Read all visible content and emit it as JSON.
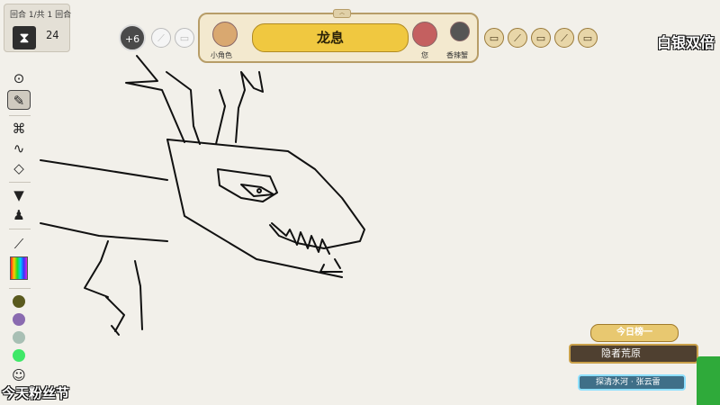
{
  "round": {
    "label": "回合 1/共 1 回合",
    "timer": "24",
    "hourglass_icon": "hourglass-icon"
  },
  "toolbar": {
    "tools": [
      {
        "name": "dot-brush-icon",
        "glyph": "⊙",
        "selected": false
      },
      {
        "name": "pen-icon",
        "glyph": "✎",
        "selected": true
      },
      {
        "name": "shape-tool-icon",
        "glyph": "⌘",
        "selected": false
      },
      {
        "name": "squiggle-icon",
        "glyph": "∿",
        "selected": false
      },
      {
        "name": "eraser-icon",
        "glyph": "◇",
        "selected": false
      },
      {
        "name": "fill-bucket-icon",
        "glyph": "▼",
        "selected": false
      },
      {
        "name": "stamp-icon",
        "glyph": "♟",
        "selected": false
      },
      {
        "name": "eyedropper-icon",
        "glyph": "⟋",
        "selected": false
      }
    ],
    "swatches": [
      "#5a5a1e",
      "#8a6bb0",
      "#a8bfb4",
      "#3fe868"
    ],
    "palette_icon": "palette-icon"
  },
  "players": {
    "bonus": "+6",
    "word": "龙息",
    "left_player": "小角色",
    "right_player1": "您",
    "right_player2": "香辣蟹"
  },
  "overlays": {
    "top_right": "白银双倍",
    "bottom_left": "今天粉丝节"
  },
  "leaderboard": {
    "title": "今日榜一",
    "first": "隐者荒原",
    "second": "探清水河 · 张云雷"
  }
}
